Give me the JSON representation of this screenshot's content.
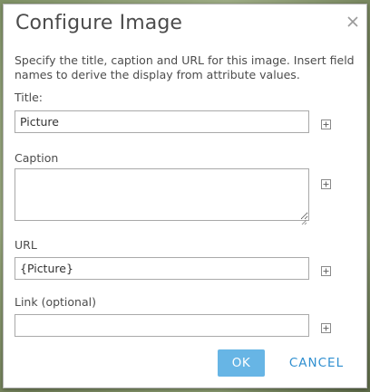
{
  "dialog": {
    "title": "Configure Image",
    "description": "Specify the title, caption and URL for this image. Insert field names to derive the display from attribute values.",
    "close_icon": "close-icon"
  },
  "fields": {
    "title": {
      "label": "Title:",
      "value": "Picture"
    },
    "caption": {
      "label": "Caption",
      "value": ""
    },
    "url": {
      "label": "URL",
      "value": "{Picture}"
    },
    "link": {
      "label": "Link (optional)",
      "value": ""
    }
  },
  "icons": {
    "insert_field": "plus-square-icon",
    "resize": "resize-grip-icon"
  },
  "buttons": {
    "ok_label": "OK",
    "cancel_label": "CANCEL"
  },
  "colors": {
    "ok_bg": "#67b5e5",
    "cancel_text": "#2f8fd0",
    "text": "#4c4c4c"
  }
}
